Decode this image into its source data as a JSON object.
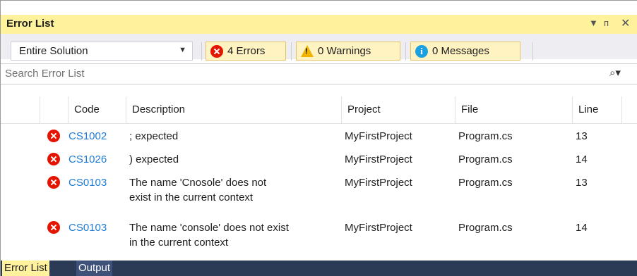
{
  "panel": {
    "title": "Error List"
  },
  "toolbar": {
    "scope": "Entire Solution",
    "errors": "4 Errors",
    "warnings": "0 Warnings",
    "messages": "0 Messages"
  },
  "search": {
    "placeholder": "Search Error List"
  },
  "columns": {
    "code": "Code",
    "description": "Description",
    "project": "Project",
    "file": "File",
    "line": "Line"
  },
  "rows": [
    {
      "code": "CS1002",
      "desc1": "; expected",
      "desc2": "",
      "project": "MyFirstProject",
      "file": "Program.cs",
      "line": "13"
    },
    {
      "code": "CS1026",
      "desc1": ") expected",
      "desc2": "",
      "project": "MyFirstProject",
      "file": "Program.cs",
      "line": "14"
    },
    {
      "code": "CS0103",
      "desc1": "The name 'Cnosole' does not",
      "desc2": "exist in the current context",
      "project": "MyFirstProject",
      "file": "Program.cs",
      "line": "13"
    },
    {
      "code": "CS0103",
      "desc1": "The name 'console' does not exist",
      "desc2": "in the current context",
      "project": "MyFirstProject",
      "file": "Program.cs",
      "line": "14"
    }
  ],
  "tabs": [
    "Error List",
    "Output"
  ],
  "icons": {
    "error": "error-icon",
    "warning": "warning-icon",
    "info": "info-icon",
    "search": "search-icon"
  },
  "colors": {
    "accent": "#fff29d",
    "error": "#e51400",
    "link": "#1e7bd5",
    "tabbar": "#2b3b56"
  }
}
